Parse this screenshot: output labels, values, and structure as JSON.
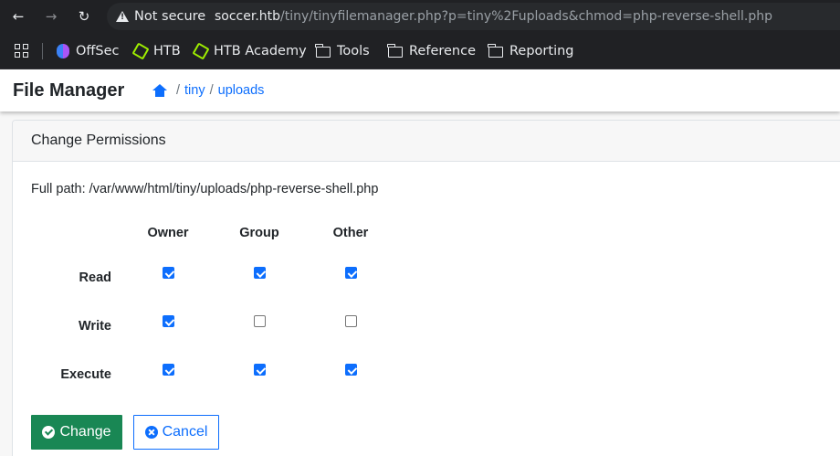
{
  "browser": {
    "security_label": "Not secure",
    "url_host": "soccer.htb",
    "url_path": "/tiny/tinyfilemanager.php?p=tiny%2Fuploads&chmod=php-reverse-shell.php",
    "nav_icons": [
      "back-arrow-icon",
      "forward-arrow-icon",
      "reload-icon"
    ]
  },
  "bookmarks": {
    "items": [
      {
        "label": "OffSec",
        "icon": "offsec-icon"
      },
      {
        "label": "HTB",
        "icon": "htb-icon"
      },
      {
        "label": "HTB Academy",
        "icon": "htb-icon"
      },
      {
        "label": "Tools",
        "icon": "folder-icon"
      },
      {
        "label": "Reference",
        "icon": "folder-icon"
      },
      {
        "label": "Reporting",
        "icon": "folder-icon"
      }
    ]
  },
  "header": {
    "brand": "File Manager",
    "breadcrumb": {
      "sep": "/",
      "items": [
        "tiny",
        "uploads"
      ]
    }
  },
  "card": {
    "title": "Change Permissions",
    "full_path": "Full path: /var/www/html/tiny/uploads/php-reverse-shell.php",
    "columns": [
      "Owner",
      "Group",
      "Other"
    ],
    "rows": [
      {
        "label": "Read",
        "checked": [
          true,
          true,
          true
        ]
      },
      {
        "label": "Write",
        "checked": [
          true,
          false,
          false
        ]
      },
      {
        "label": "Execute",
        "checked": [
          true,
          true,
          true
        ]
      }
    ],
    "change_label": "Change",
    "cancel_label": "Cancel"
  },
  "colors": {
    "primary": "#0d6efd",
    "success": "#198754",
    "chrome_bg": "#202124"
  }
}
